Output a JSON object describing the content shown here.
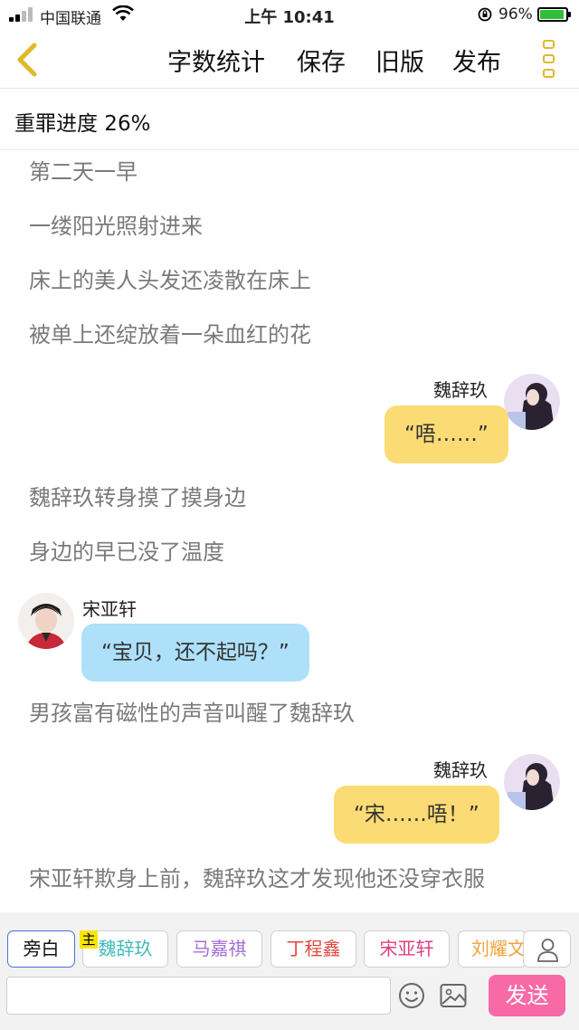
{
  "status_bar": {
    "carrier": "中国联通",
    "time": "上午 10:41",
    "battery_percent": "96%",
    "battery_level": 0.96
  },
  "nav": {
    "back_icon": "chevron-left-icon",
    "actions": [
      "字数统计",
      "保存",
      "旧版",
      "发布"
    ],
    "menu_icon": "more-vertical-icon",
    "accent_color": "#e0b92a"
  },
  "progress": {
    "text": "重罪进度 26%"
  },
  "story": {
    "narration_1": "第二天一早",
    "narration_2": "一缕阳光照射进来",
    "narration_3": "床上的美人头发还凌散在床上",
    "narration_4": "被单上还绽放着一朵血红的花",
    "msg_1": {
      "speaker": "魏辞玖",
      "text": "“唔……”"
    },
    "narration_5": "魏辞玖转身摸了摸身边",
    "narration_6": "身边的早已没了温度",
    "msg_2": {
      "speaker": "宋亚轩",
      "text": "“宝贝，还不起吗？”"
    },
    "narration_7": "男孩富有磁性的声音叫醒了魏辞玖",
    "msg_3": {
      "speaker": "魏辞玖",
      "text": "“宋……唔！”"
    },
    "narration_8": "宋亚轩欺身上前，魏辞玖这才发现他还没穿衣服"
  },
  "characters": {
    "main_badge": "主",
    "chips": [
      {
        "label": "旁白",
        "color": "#111111"
      },
      {
        "label": "魏辞玖",
        "color": "#3fbcb8"
      },
      {
        "label": "马嘉祺",
        "color": "#a36fd6"
      },
      {
        "label": "丁程鑫",
        "color": "#e2463f"
      },
      {
        "label": "宋亚轩",
        "color": "#e0407e"
      },
      {
        "label": "刘耀文",
        "color": "#f2a23a"
      }
    ]
  },
  "composer": {
    "input_value": "",
    "send_label": "发送",
    "send_color": "#f86aa6"
  }
}
